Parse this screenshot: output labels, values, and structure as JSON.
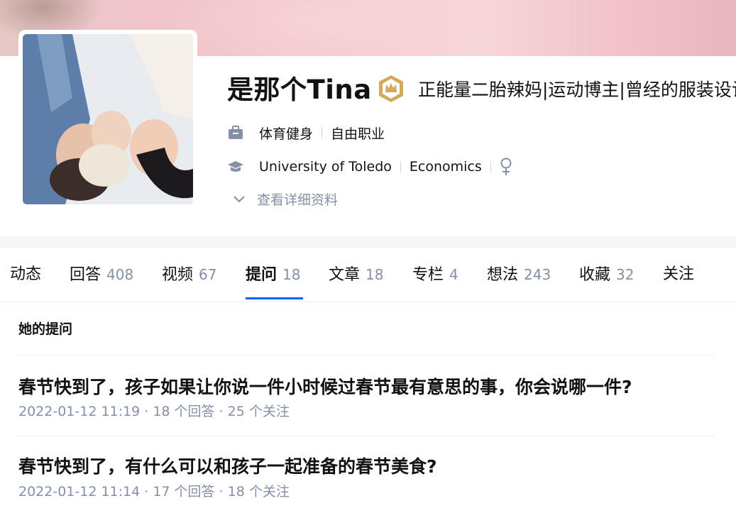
{
  "profile": {
    "name": "是那个Tina",
    "headline": "正能量二胎辣妈|运动博主|曾经的服装设计师",
    "industry": "体育健身",
    "occupation": "自由职业",
    "school": "University of Toledo",
    "major": "Economics",
    "expand_label": "查看详细资料",
    "icons": {
      "industry": "briefcase-icon",
      "education": "graduation-cap-icon",
      "gender": "female-icon",
      "badge": "crown-badge-icon",
      "expand": "chevron-down-icon"
    }
  },
  "tabs": [
    {
      "label": "动态",
      "count": ""
    },
    {
      "label": "回答",
      "count": "408"
    },
    {
      "label": "视频",
      "count": "67"
    },
    {
      "label": "提问",
      "count": "18",
      "active": true
    },
    {
      "label": "文章",
      "count": "18"
    },
    {
      "label": "专栏",
      "count": "4"
    },
    {
      "label": "想法",
      "count": "243"
    },
    {
      "label": "收藏",
      "count": "32"
    },
    {
      "label": "关注",
      "count": ""
    }
  ],
  "section_title": "她的提问",
  "questions": [
    {
      "title": "春节快到了，孩子如果让你说一件小时候过春节最有意思的事，你会说哪一件?",
      "meta": "2022-01-12 11:19 · 18 个回答 · 25 个关注"
    },
    {
      "title": "春节快到了，有什么可以和孩子一起准备的春节美食?",
      "meta": "2022-01-12 11:14 · 17 个回答 · 18 个关注"
    }
  ],
  "colors": {
    "accent": "#0066ff",
    "muted": "#8590a6",
    "badge": "#d6a85a"
  }
}
